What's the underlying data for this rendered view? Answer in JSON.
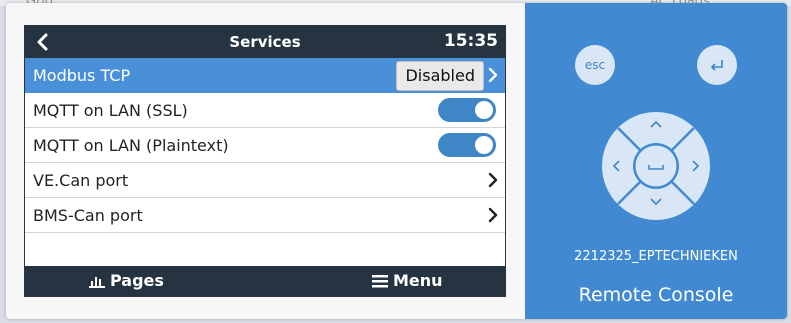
{
  "background": {
    "left_text": "Grid",
    "right_text": "AC Loads"
  },
  "screen": {
    "title": "Services",
    "clock": "15:35",
    "rows": [
      {
        "label": "Modbus TCP",
        "value": "Disabled",
        "kind": "submenu",
        "selected": true
      },
      {
        "label": "MQTT on LAN (SSL)",
        "kind": "toggle",
        "on": true
      },
      {
        "label": "MQTT on LAN (Plaintext)",
        "kind": "toggle",
        "on": true
      },
      {
        "label": "VE.Can port",
        "kind": "submenu"
      },
      {
        "label": "BMS-Can port",
        "kind": "submenu"
      }
    ],
    "bottom": {
      "pages_label": "Pages",
      "menu_label": "Menu"
    }
  },
  "panel": {
    "esc_label": "esc",
    "enter_icon": "return-icon",
    "device_name": "2212325_EPTECHNIEKEN",
    "console_label": "Remote Console"
  },
  "colors": {
    "title_bar": "#263340",
    "selected_row": "#4a90d9",
    "toggle_on": "#3f86c6",
    "panel": "#418ad2"
  }
}
